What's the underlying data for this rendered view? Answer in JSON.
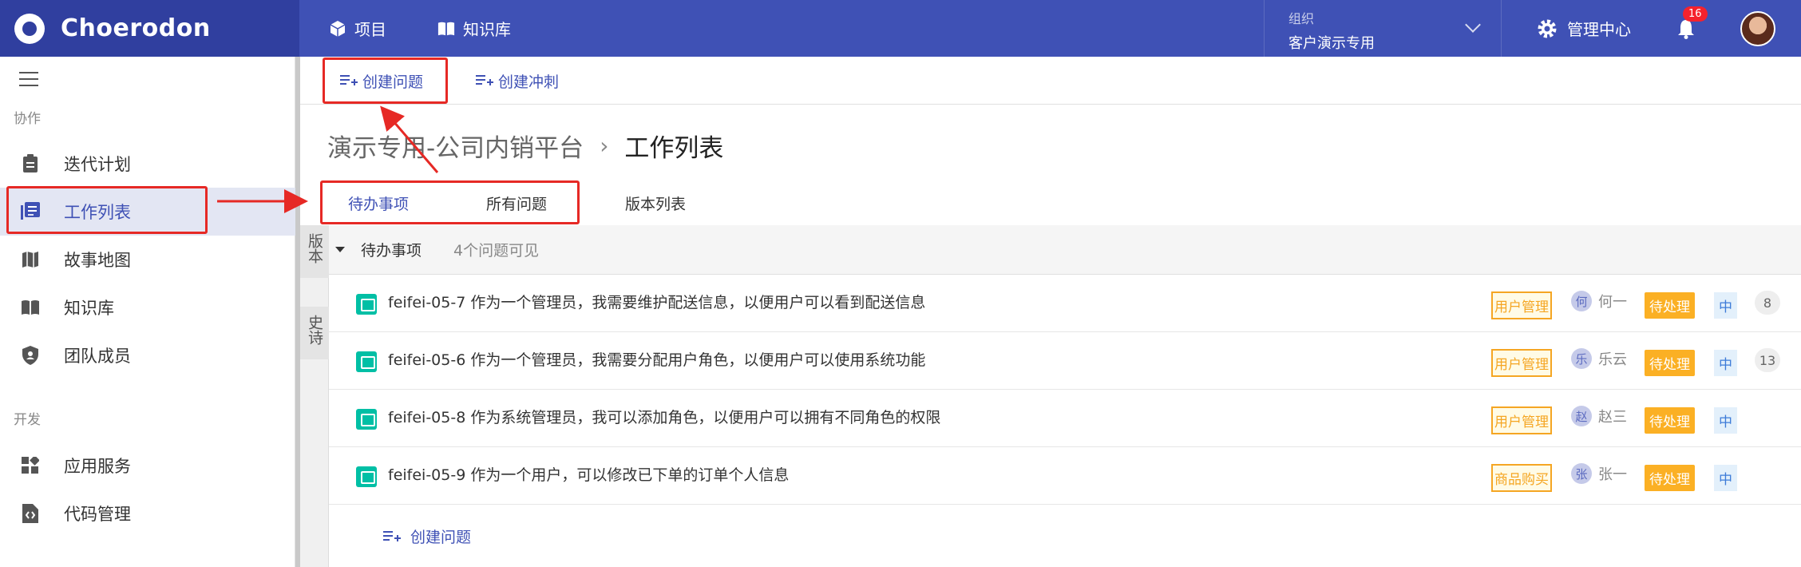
{
  "app": {
    "name": "Choerodon"
  },
  "topnav": {
    "items": [
      {
        "label": "项目",
        "icon": "cube-icon"
      },
      {
        "label": "知识库",
        "icon": "book-open-icon"
      }
    ],
    "org": {
      "label": "组织",
      "name": "客户演示专用"
    },
    "mgmt_label": "管理中心",
    "notification_count": "16"
  },
  "sidebar": {
    "sections": [
      {
        "title": "协作",
        "items": [
          {
            "label": "迭代计划",
            "icon": "clipboard-icon",
            "active": false
          },
          {
            "label": "工作列表",
            "icon": "list-icon",
            "active": true
          },
          {
            "label": "故事地图",
            "icon": "map-icon",
            "active": false
          },
          {
            "label": "知识库",
            "icon": "book-open-icon",
            "active": false
          },
          {
            "label": "团队成员",
            "icon": "shield-icon",
            "active": false
          }
        ]
      },
      {
        "title": "开发",
        "items": [
          {
            "label": "应用服务",
            "icon": "widgets-icon",
            "active": false
          },
          {
            "label": "代码管理",
            "icon": "code-file-icon",
            "active": false
          }
        ]
      }
    ]
  },
  "toolbar": {
    "create_issue": "创建问题",
    "create_sprint": "创建冲刺"
  },
  "breadcrumb": {
    "project": "演示专用-公司内销平台",
    "sep": "›",
    "current": "工作列表"
  },
  "tabs": [
    {
      "label": "待办事项",
      "active": true
    },
    {
      "label": "所有问题",
      "active": false
    },
    {
      "label": "版本列表",
      "active": false
    }
  ],
  "side_tabs": [
    "版本",
    "史诗"
  ],
  "backlog": {
    "title": "待办事项",
    "count": "4个问题可见",
    "issues": [
      {
        "text": "feifei-05-7 作为一个管理员，我需要维护配送信息，以便用户可以看到配送信息",
        "tag": "用户管理",
        "assignee_initial": "何",
        "assignee": "何一",
        "status": "待处理",
        "priority": "中",
        "points": "8"
      },
      {
        "text": "feifei-05-6 作为一个管理员，我需要分配用户角色，以便用户可以使用系统功能",
        "tag": "用户管理",
        "assignee_initial": "乐",
        "assignee": "乐云",
        "status": "待处理",
        "priority": "中",
        "points": "13"
      },
      {
        "text": "feifei-05-8 作为系统管理员，我可以添加角色，以便用户可以拥有不同角色的权限",
        "tag": "用户管理",
        "assignee_initial": "赵",
        "assignee": "赵三",
        "status": "待处理",
        "priority": "中",
        "points": ""
      },
      {
        "text": "feifei-05-9 作为一个用户，可以修改已下单的订单个人信息",
        "tag": "商品购买",
        "assignee_initial": "张",
        "assignee": "张一",
        "status": "待处理",
        "priority": "中",
        "points": ""
      }
    ],
    "create_label": "创建问题"
  },
  "colors": {
    "primary": "#3f51b5",
    "primary_dark": "#303f9f",
    "annotation": "#e62925",
    "status": "#fbb024",
    "story": "#00bfa5"
  }
}
